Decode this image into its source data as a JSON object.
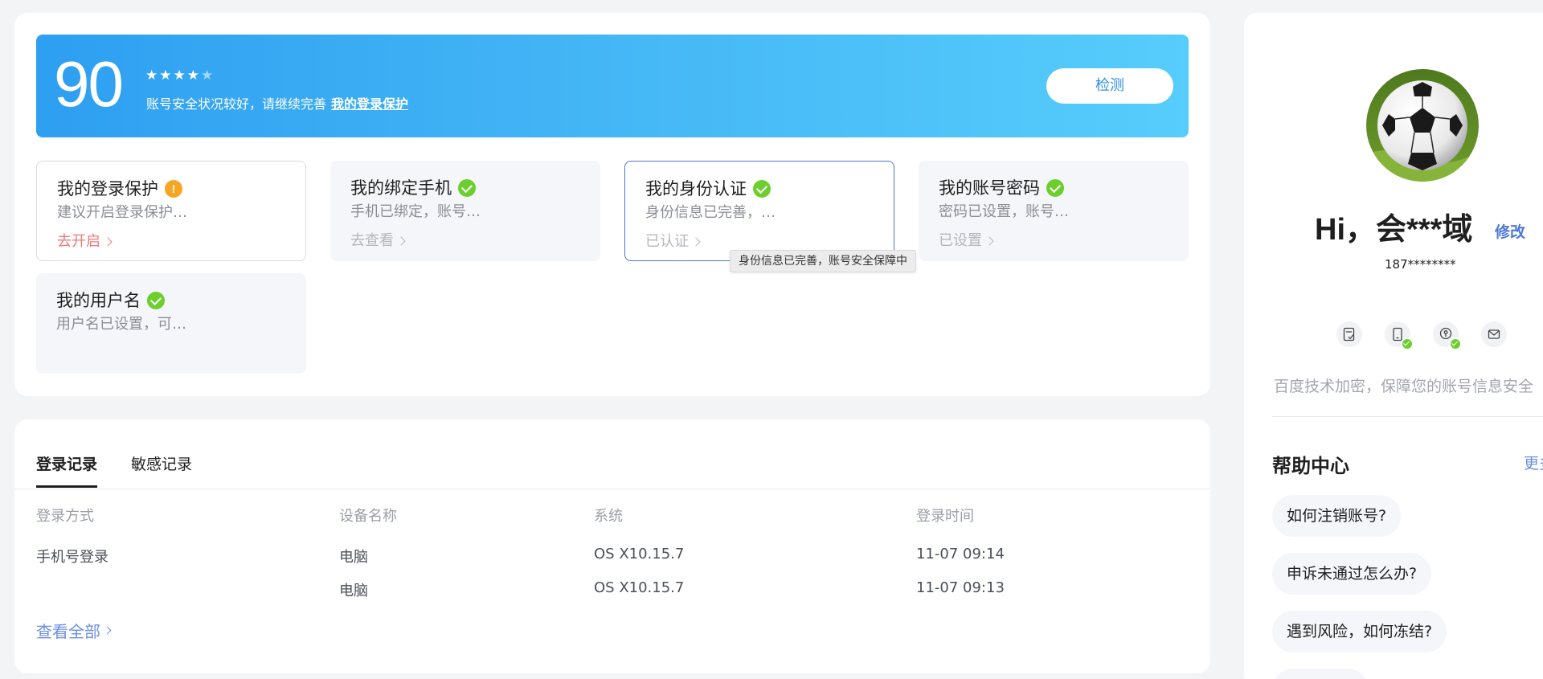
{
  "score": {
    "value": "90",
    "stars_total": 5,
    "stars_filled": 4,
    "message": "账号安全状况较好，请继续完善",
    "link": "我的登录保护",
    "detect_button": "检测"
  },
  "tiles": [
    {
      "title": "我的登录保护",
      "status": "warning",
      "desc": "建议开启登录保护…",
      "action": "去开启"
    },
    {
      "title": "我的绑定手机",
      "status": "ok",
      "desc": "手机已绑定，账号…",
      "action": "去查看"
    },
    {
      "title": "我的身份认证",
      "status": "ok",
      "desc": "身份信息已完善，…",
      "action": "已认证"
    },
    {
      "title": "我的账号密码",
      "status": "ok",
      "desc": "密码已设置，账号…",
      "action": "已设置"
    },
    {
      "title": "我的用户名",
      "status": "ok",
      "desc": "用户名已设置，可…",
      "action": ""
    }
  ],
  "tooltip": "身份信息已完善，账号安全保障中",
  "records": {
    "tabs": [
      "登录记录",
      "敏感记录"
    ],
    "active_tab": 0,
    "columns": [
      "登录方式",
      "设备名称",
      "系统",
      "登录时间"
    ],
    "rows": [
      [
        "手机号登录",
        "电脑",
        "OS X10.15.7",
        "11-07 09:14"
      ],
      [
        "",
        "电脑",
        "OS X10.15.7",
        "11-07 09:13"
      ]
    ],
    "view_all": "查看全部"
  },
  "profile": {
    "greeting": "Hi，会***域",
    "edit": "修改",
    "phone": "187********",
    "security_icons": [
      "document-check-icon",
      "phone-icon",
      "key-icon",
      "mail-icon"
    ],
    "encrypt_text": "百度技术加密，保障您的账号信息安全",
    "help_title": "帮助中心",
    "help_more": "更多",
    "help_items": [
      "如何注销账号?",
      "申诉未通过怎么办?",
      "遇到风险，如何冻结?"
    ]
  },
  "colors": {
    "accent": "#4d78d6",
    "banner_start": "#2e9ff1",
    "banner_end": "#56cdfc",
    "ok_green": "#6ccf2e",
    "warn_orange": "#f6a623"
  }
}
